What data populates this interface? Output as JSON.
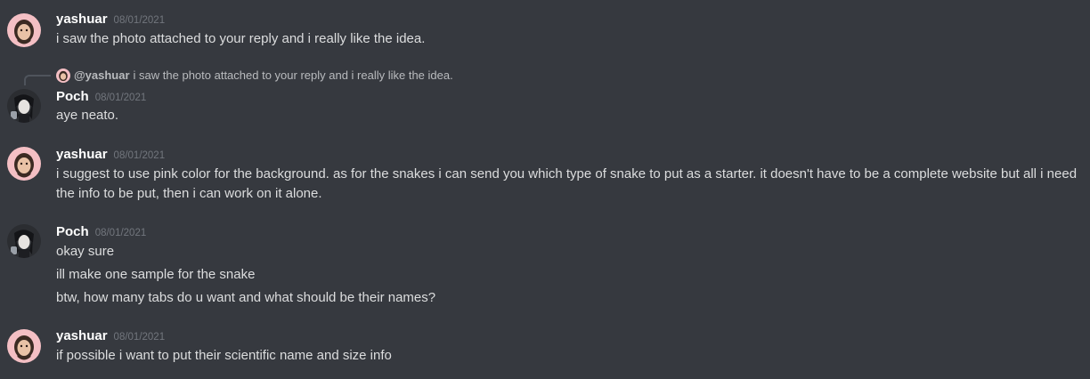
{
  "messages": [
    {
      "author": "yashuar",
      "timestamp": "08/01/2021",
      "avatar_icon": "pink-avatar-icon",
      "lines": [
        "i saw the photo attached to your reply and i really like the idea."
      ]
    },
    {
      "author": "Poch",
      "timestamp": "08/01/2021",
      "avatar_icon": "dark-avatar-icon",
      "reply": {
        "mention": "@yashuar",
        "text": "i saw the photo attached to your reply and i really like the idea."
      },
      "lines": [
        "aye neato."
      ]
    },
    {
      "author": "yashuar",
      "timestamp": "08/01/2021",
      "avatar_icon": "pink-avatar-icon",
      "lines": [
        "i suggest to use pink color for the background. as for the snakes i can send you which type of snake to put as a starter. it doesn't have to be a complete website but all i need the info to be put, then i can work on it alone."
      ]
    },
    {
      "author": "Poch",
      "timestamp": "08/01/2021",
      "avatar_icon": "dark-avatar-icon",
      "lines": [
        "okay sure",
        "ill make one sample for the snake",
        "btw, how many tabs do u want and what should be their names?"
      ]
    },
    {
      "author": "yashuar",
      "timestamp": "08/01/2021",
      "avatar_icon": "pink-avatar-icon",
      "lines": [
        "if possible i want to put their scientific name and size info"
      ]
    }
  ],
  "colors": {
    "background": "#36393f",
    "username": "#ffffff",
    "text": "#dcddde",
    "timestamp": "#72767d",
    "pink_avatar": "#f4bfc4"
  }
}
